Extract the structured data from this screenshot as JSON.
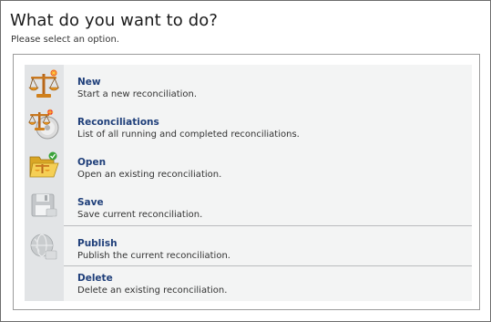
{
  "header": {
    "title": "What do you want to do?",
    "subtitle": "Please select an option."
  },
  "options": [
    {
      "id": "new",
      "title": "New",
      "description": "Start a new reconciliation.",
      "icon": "scales-new-icon"
    },
    {
      "id": "reconciliations",
      "title": "Reconciliations",
      "description": "List of all running and completed reconciliations.",
      "icon": "scales-disc-icon"
    },
    {
      "id": "open",
      "title": "Open",
      "description": "Open an existing reconciliation.",
      "icon": "folder-open-icon"
    },
    {
      "id": "save",
      "title": "Save",
      "description": "Save current reconciliation.",
      "icon": "floppy-disk-icon"
    },
    {
      "id": "publish",
      "title": "Publish",
      "description": "Publish the current reconciliation.",
      "icon": "globe-publish-icon"
    },
    {
      "id": "delete",
      "title": "Delete",
      "description": "Delete an existing reconciliation.",
      "icon": ""
    }
  ],
  "colors": {
    "title_link": "#1f3f7a",
    "icon_column": "#e2e4e6",
    "list_background": "#f3f4f4",
    "separator": "#b9bbbd"
  }
}
